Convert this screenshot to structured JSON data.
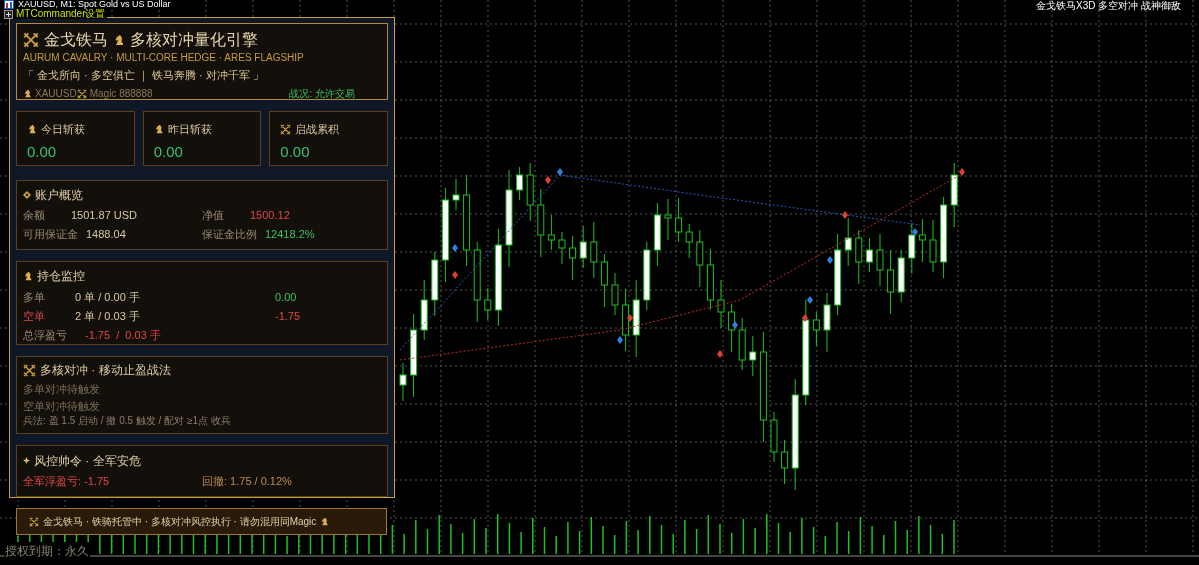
{
  "chart_header": {
    "title": "XAUUSD, M1:  Spot Gold vs US Dollar",
    "top_right": "金戈铁马X3D 多空对冲 战神御敌"
  },
  "toolbar_label": "MTCommander设置",
  "panel": {
    "title": "金戈铁马",
    "title2": "多核对冲量化引擎",
    "subtitle": "AURUM CAVALRY · MULTI-CORE HEDGE · ARES FLAGSHIP",
    "motto": "「 金戈所向 · 多空俱亡 ｜ 铁马奔腾 · 对冲千军 」",
    "symbol": "XAUUSD",
    "magic": "Magic 888888",
    "status": "战况: 允许交易"
  },
  "stats": [
    {
      "kind": "knight",
      "label": "今日斩获",
      "value": "0.00"
    },
    {
      "kind": "knight",
      "label": "昨日斩获",
      "value": "0.00"
    },
    {
      "kind": "swords",
      "label": "启战累积",
      "value": "0.00"
    }
  ],
  "account": {
    "title": "账户概览",
    "rows": [
      {
        "label": "余额",
        "value": "1501.87 USD",
        "color": "#d8c8a0"
      },
      {
        "label": "净值",
        "value": "1500.12",
        "color": "#e04848"
      },
      {
        "label": "可用保证金",
        "value": "1488.04",
        "color": "#d8c8a0"
      },
      {
        "label": "保证金比例",
        "value": "12418.2%",
        "color": "#3cc060"
      }
    ]
  },
  "positions": {
    "title": "持仓监控",
    "rows": [
      {
        "kind": "long",
        "label": "多单",
        "orders": "0 单 / 0.00 手",
        "pnl": "0.00"
      },
      {
        "kind": "short",
        "label": "空单",
        "orders": "2 单 / 0.03 手",
        "pnl": "-1.75"
      }
    ],
    "total_label": "总浮盈亏",
    "total_value": "-1.75  /  0.03 手"
  },
  "strategy": {
    "title": "多核对冲 · 移动止盈战法",
    "lines": [
      "多单对冲待触发",
      "空单对冲待触发"
    ],
    "rule": "兵法: 盈 1.5 启动 / 撤 0.5 触发 / 配对 ≥1点 收兵"
  },
  "risk": {
    "title": "风控帅令 · 全军安危",
    "float": "全军浮盈亏: -1.75",
    "drawdown": "回撤: 1.75 / 0.12%"
  },
  "banner": "金戈铁马 · 铁骑托管中 · 多核对冲风控执行 · 请勿混用同Magic",
  "license": "授权到期：永久"
}
